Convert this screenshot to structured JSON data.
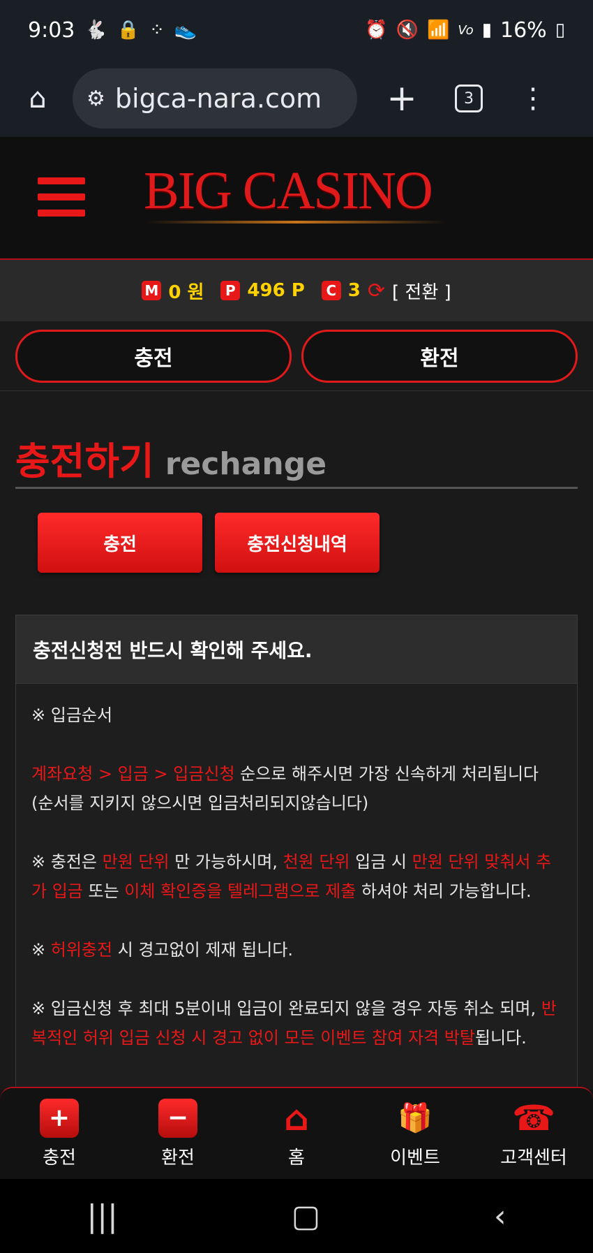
{
  "status_bar": {
    "time": "9:03",
    "battery": "16%",
    "left_icons": [
      "rabbit-icon",
      "lock-icon",
      "dots-icon",
      "shoe-icon"
    ],
    "right_icons": [
      "alarm-icon",
      "mute-icon",
      "wifi-icon",
      "volte-icon",
      "signal-icon",
      "battery-icon"
    ]
  },
  "browser": {
    "url": "bigca-nara.com",
    "tab_count": "3"
  },
  "header": {
    "logo": "BIG CASINO"
  },
  "points": {
    "m_badge": "M",
    "m_value": "0 원",
    "p_badge": "P",
    "p_value": "496 P",
    "c_badge": "C",
    "c_value": "3",
    "switch_label": "[ 전환 ]"
  },
  "actions": {
    "charge": "충전",
    "exchange": "환전"
  },
  "section": {
    "title_kr": "충전하기",
    "title_en": "rechange"
  },
  "tabs": {
    "charge": "충전",
    "history": "충전신청내역"
  },
  "notice": {
    "heading": "충전신청전 반드시 확인해 주세요.",
    "p1": "※ 입금순서",
    "p2_red": "계좌요청 > 입금 > 입금신청",
    "p2_rest": " 순으로 해주시면 가장 신속하게 처리됩니다",
    "p2_line2": "(순서를 지키지 않으시면 입금처리되지않습니다)",
    "p3_a": "※ 충전은 ",
    "p3_b": "만원 단위",
    "p3_c": " 만 가능하시며, ",
    "p3_d": "천원 단위",
    "p3_e": " 입금 시 ",
    "p3_f": "만원 단위 맞춰서 추가 입금",
    "p3_g": " 또는 ",
    "p3_h": "이체 확인증을 텔레그램으로 제출",
    "p3_i": " 하셔야 처리 가능합니다.",
    "p4_a": "※ ",
    "p4_b": "허위충전",
    "p4_c": " 시 경고없이 제재 됩니다.",
    "p5_a": "※ 입금신청 후 최대 5분이내 입금이 완료되지 않을 경우 자동 취소 되며, ",
    "p5_b": "반복적인 허위 입금 신청 시 경고 없이 모든 이벤트 참여 자격 박탈",
    "p5_c": "됩니다."
  },
  "bottom_nav": [
    {
      "label": "충전",
      "icon": "+"
    },
    {
      "label": "환전",
      "icon": "−"
    },
    {
      "label": "홈",
      "icon": "⌂"
    },
    {
      "label": "이벤트",
      "icon": "🎁"
    },
    {
      "label": "고객센터",
      "icon": "☎"
    }
  ],
  "colors": {
    "accent_red": "#e81818",
    "points_yellow": "#ffd200",
    "background": "#1a1a1a"
  }
}
